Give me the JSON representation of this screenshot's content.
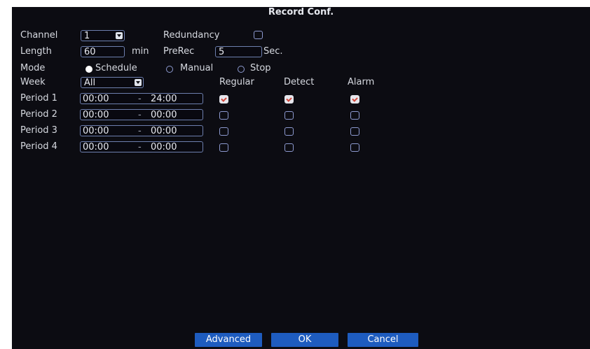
{
  "window": {
    "title": "Record Conf."
  },
  "channel": {
    "label": "Channel",
    "value": "1"
  },
  "redundancy": {
    "label": "Redundancy",
    "checked": false
  },
  "length": {
    "label": "Length",
    "value": "60",
    "unit": "min"
  },
  "prerec": {
    "label": "PreRec",
    "value": "5",
    "unit": "Sec."
  },
  "mode": {
    "label": "Mode",
    "options": [
      "Schedule",
      "Manual",
      "Stop"
    ],
    "selected": "Schedule"
  },
  "week": {
    "label": "Week",
    "value": "All"
  },
  "columns": {
    "regular": "Regular",
    "detect": "Detect",
    "alarm": "Alarm"
  },
  "periods": [
    {
      "label": "Period 1",
      "start": "00:00",
      "sep": "-",
      "end": "24:00",
      "regular": true,
      "detect": true,
      "alarm": true
    },
    {
      "label": "Period 2",
      "start": "00:00",
      "sep": "-",
      "end": "00:00",
      "regular": false,
      "detect": false,
      "alarm": false
    },
    {
      "label": "Period 3",
      "start": "00:00",
      "sep": "-",
      "end": "00:00",
      "regular": false,
      "detect": false,
      "alarm": false
    },
    {
      "label": "Period 4",
      "start": "00:00",
      "sep": "-",
      "end": "00:00",
      "regular": false,
      "detect": false,
      "alarm": false
    }
  ],
  "buttons": {
    "advanced": "Advanced",
    "ok": "OK",
    "cancel": "Cancel"
  },
  "colors": {
    "background": "#0c0c12",
    "button": "#1e5cbf",
    "field_border": "#6d7fae",
    "checkmark": "#d2473a"
  }
}
